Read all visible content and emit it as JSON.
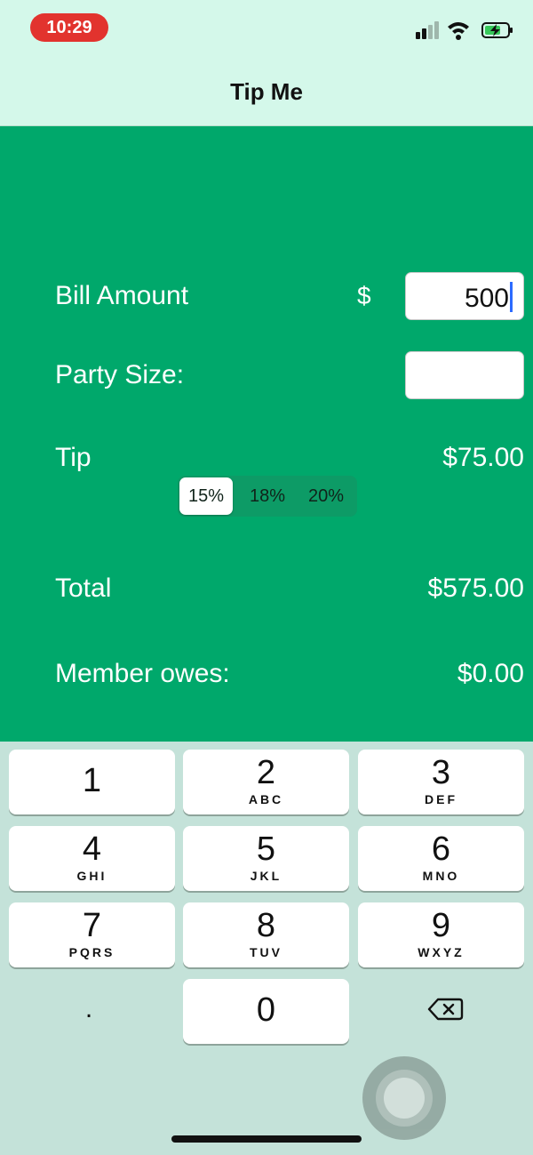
{
  "status_bar": {
    "time": "10:29",
    "signal_icon": "signal-icon",
    "wifi_icon": "wifi-icon",
    "battery_icon": "battery-charging-icon"
  },
  "nav": {
    "title": "Tip Me"
  },
  "form": {
    "bill_label": "Bill Amount",
    "currency_symbol": "$",
    "bill_value": "500",
    "party_label": "Party Size:",
    "party_value": "",
    "tip_label": "Tip",
    "tip_value": "$75.00",
    "tip_options": [
      "15%",
      "18%",
      "20%"
    ],
    "tip_selected": "15%",
    "total_label": "Total",
    "total_value": "$575.00",
    "member_label": "Member owes:",
    "member_value": "$0.00"
  },
  "keyboard": {
    "keys": [
      {
        "digit": "1",
        "letters": ""
      },
      {
        "digit": "2",
        "letters": "ABC"
      },
      {
        "digit": "3",
        "letters": "DEF"
      },
      {
        "digit": "4",
        "letters": "GHI"
      },
      {
        "digit": "5",
        "letters": "JKL"
      },
      {
        "digit": "6",
        "letters": "MNO"
      },
      {
        "digit": "7",
        "letters": "PQRS"
      },
      {
        "digit": "8",
        "letters": "TUV"
      },
      {
        "digit": "9",
        "letters": "WXYZ"
      },
      {
        "digit": "0",
        "letters": ""
      }
    ],
    "decimal": ".",
    "backspace_icon": "backspace-icon"
  },
  "colors": {
    "header_background": "#d4f8ea",
    "content_background": "#00a86b",
    "keyboard_background": "#c4e2d9",
    "recording_pill": "#e2332e",
    "cursor": "#2c6bff"
  },
  "assistive_touch_icon": "assistive-touch-icon"
}
